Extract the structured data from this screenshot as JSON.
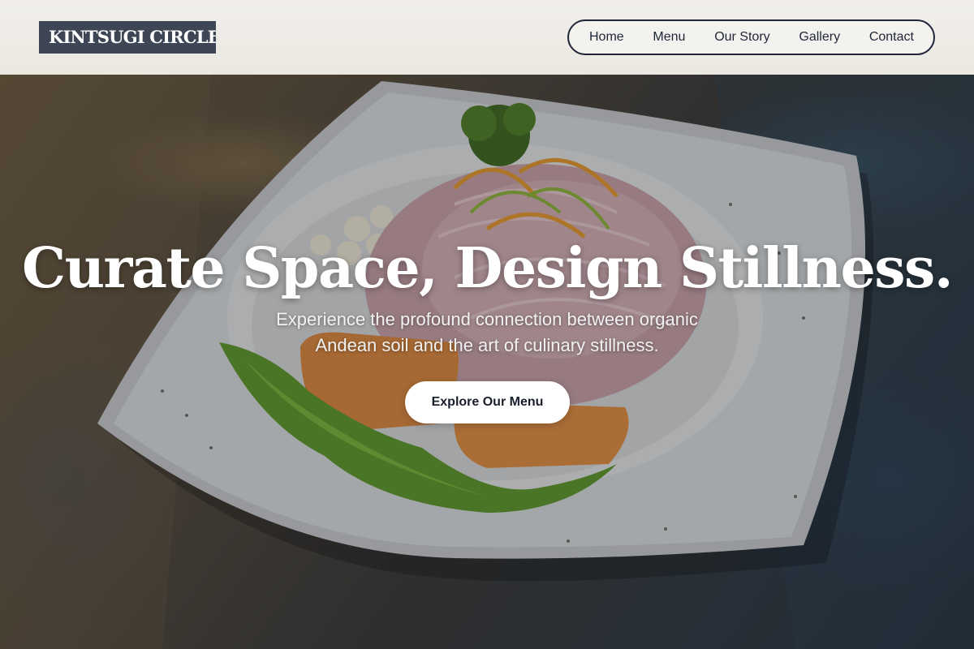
{
  "brand": {
    "name": "KINTSUGI CIRCLE"
  },
  "nav": {
    "items": [
      {
        "label": "Home"
      },
      {
        "label": "Menu"
      },
      {
        "label": "Our Story"
      },
      {
        "label": "Gallery"
      },
      {
        "label": "Contact"
      }
    ]
  },
  "hero": {
    "title": "Curate Space, Design Stillness.",
    "subtitle": "Experience the profound connection between organic Andean soil and the art of culinary stillness.",
    "cta_label": "Explore Our Menu",
    "image_icon": "ceviche-plate-photo"
  },
  "colors": {
    "header_bg": "#efede8",
    "logo_bg": "#3e4656",
    "nav_border": "#1f2638",
    "cta_bg": "#ffffff",
    "cta_text": "#1a1f2c"
  }
}
